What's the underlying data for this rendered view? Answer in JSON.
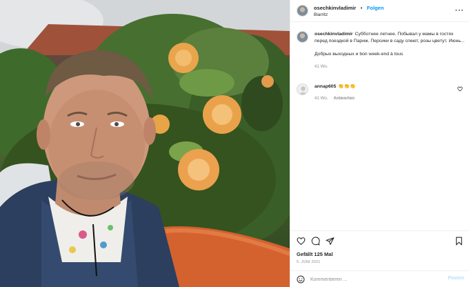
{
  "post": {
    "username": "osechkinvladimir",
    "separator": "•",
    "follow_label": "Folgen",
    "location": "Biarritz",
    "more_label": "···",
    "caption": "Субботнее летнее. Побывал у мамы в гостях перед поездкой в Париж. Персики в саду спеют, розы цветут. Июнь...",
    "caption_line2": "Добрых выходных и bon week-end à tous",
    "caption_time": "41 Wo.",
    "comments": [
      {
        "username": "annap605",
        "text": "👏👏👏",
        "time": "41 Wo.",
        "reply_label": "Antworten"
      }
    ],
    "likes": "Gefällt 125 Mal",
    "date": "5. JUNI 2021",
    "comment_placeholder": "Kommentieren ...",
    "post_button": "Posten"
  },
  "icons": {
    "like": "heart-icon",
    "comment": "comment-icon",
    "share": "paper-plane-icon",
    "save": "bookmark-icon",
    "emoji": "smiley-icon",
    "more": "more-dots-icon"
  },
  "colors": {
    "follow": "#0095f6",
    "post_button_disabled": "#b2dffc",
    "meta_text": "#8e8e8e",
    "text": "#262626"
  }
}
